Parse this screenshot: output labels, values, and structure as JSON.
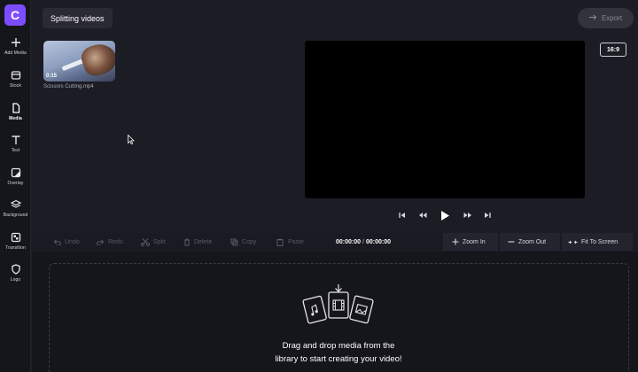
{
  "app": {
    "logo_letter": "C",
    "accent_color": "#7c4dff"
  },
  "rail": [
    {
      "label": "Add Media",
      "icon": "plus-icon"
    },
    {
      "label": "Stock",
      "icon": "stock-icon"
    },
    {
      "label": "Media",
      "icon": "file-icon"
    },
    {
      "label": "Text",
      "icon": "text-icon"
    },
    {
      "label": "Overlay",
      "icon": "overlay-icon"
    },
    {
      "label": "Background",
      "icon": "layers-icon"
    },
    {
      "label": "Transition",
      "icon": "transition-icon"
    },
    {
      "label": "Logo",
      "icon": "shield-icon"
    }
  ],
  "project_title": "Splitting videos",
  "export_label": "Export",
  "media": {
    "duration": "0:15",
    "name": "Scissors Cutting.mp4"
  },
  "aspect_ratio": "16:9",
  "toolbar": {
    "undo": "Undo",
    "redo": "Redo",
    "split": "Split",
    "delete": "Delete",
    "copy": "Copy",
    "paste": "Paste",
    "time_current": "00:00:00",
    "time_total": "00:00:00",
    "time_sep": "/",
    "zoom_in": "Zoom In",
    "zoom_out": "Zoom Out",
    "fit": "Fit To Screen"
  },
  "timeline": {
    "drop_line1": "Drag and drop media from the",
    "drop_line2": "library to start creating your video!"
  }
}
